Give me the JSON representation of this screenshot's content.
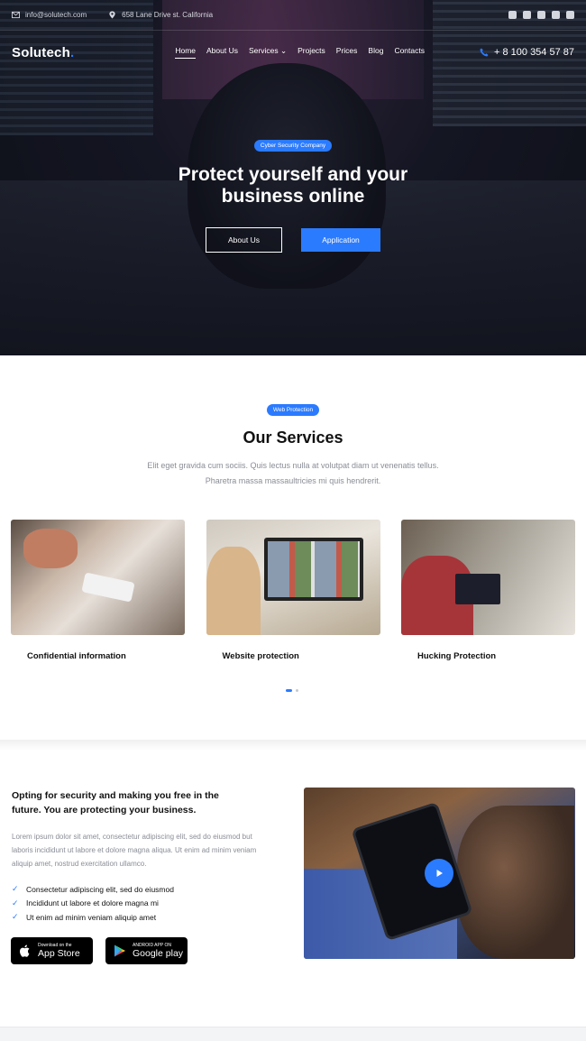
{
  "topbar": {
    "email": "info@solutech.com",
    "address": "658 Lane Drive st. California",
    "social": [
      "facebook-icon",
      "twitter-icon",
      "youtube-icon",
      "github-icon",
      "linkedin-icon"
    ]
  },
  "nav": {
    "logo": "Solutech",
    "logo_dot": ".",
    "items": [
      "Home",
      "About Us",
      "Services",
      "Projects",
      "Prices",
      "Blog",
      "Contacts"
    ],
    "services_arrow": "⌄",
    "phone": "+ 8 100 354 57 87"
  },
  "hero": {
    "badge": "Cyber Security Company",
    "title_line1": "Protect yourself and your",
    "title_line2": "business online",
    "btn_about": "About Us",
    "btn_application": "Application"
  },
  "services": {
    "badge": "Web Protection",
    "title": "Our Services",
    "desc_line1": "Elit eget gravida cum sociis. Quis lectus nulla at volutpat diam ut venenatis tellus.",
    "desc_line2": "Pharetra massa massaultricies mi quis hendrerit.",
    "cards": [
      {
        "caption": "Confidential information"
      },
      {
        "caption": "Website protection"
      },
      {
        "caption": "Hucking Protection"
      }
    ]
  },
  "feature": {
    "title": "Opting for security and making you free in the future. You are protecting your business.",
    "desc": "Lorem ipsum dolor sit amet, consectetur adipiscing elit, sed do eiusmod but laboris incididunt ut labore et dolore magna aliqua. Ut enim ad minim veniam aliquip amet, nostrud exercitation ullamco.",
    "checks": [
      "Consectetur adipiscing elit, sed do eiusmod",
      "Incididunt ut labore et dolore magna mi",
      "Ut enim ad minim veniam aliquip amet"
    ],
    "appstore_small": "Download on the",
    "appstore_big": "App Store",
    "googleplay_small": "ANDROID APP ON",
    "googleplay_big": "Google play"
  },
  "colors": {
    "accent": "#2b7bff",
    "hero_bg": "#1b1c29"
  }
}
